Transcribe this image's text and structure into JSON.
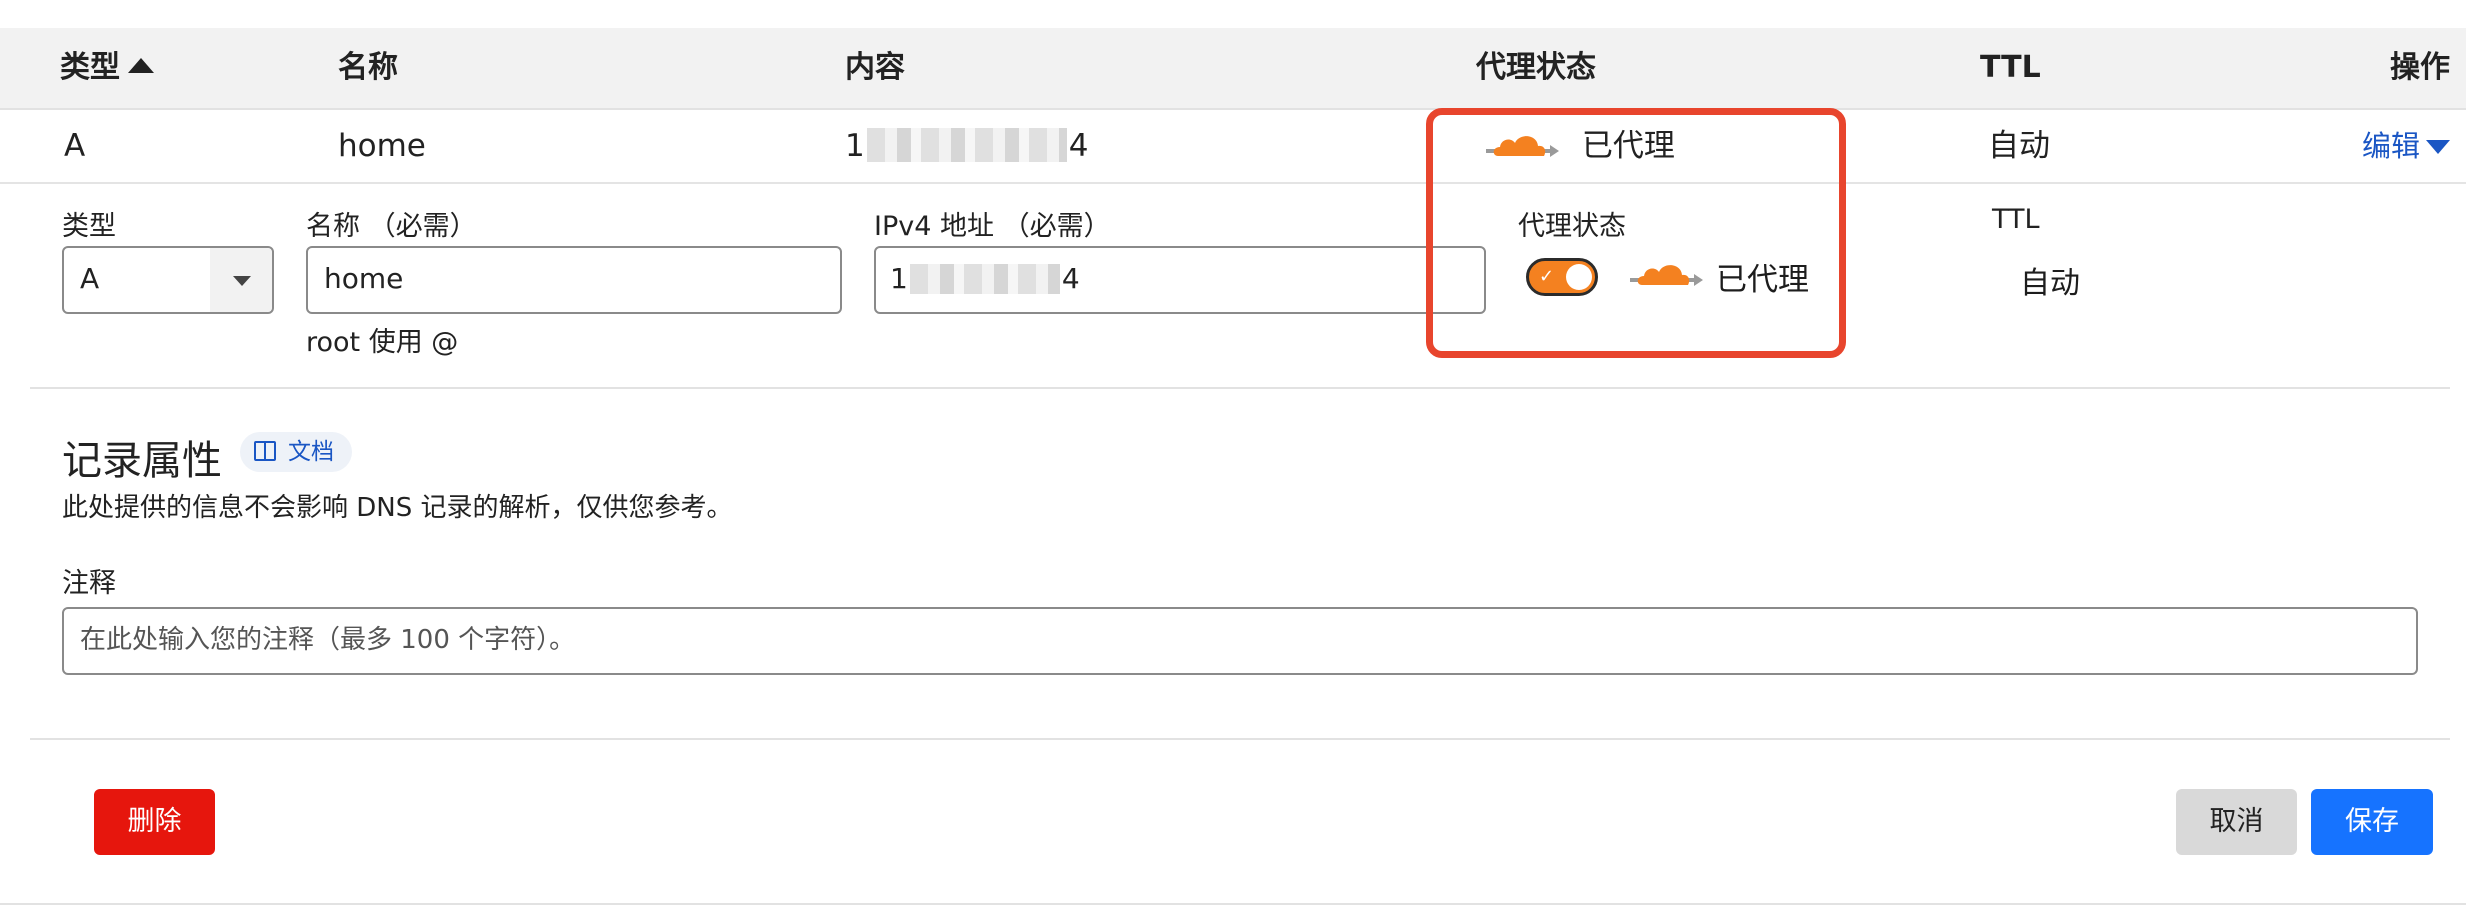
{
  "table": {
    "headers": {
      "type": "类型",
      "name": "名称",
      "content": "内容",
      "proxy": "代理状态",
      "ttl": "TTL",
      "actions": "操作"
    }
  },
  "record": {
    "type": "A",
    "name": "home",
    "content_start": "1",
    "content_end": "4",
    "proxy_status": "已代理",
    "ttl": "自动",
    "edit_label": "编辑"
  },
  "form": {
    "type_label": "类型",
    "type_value": "A",
    "name_label": "名称 （必需）",
    "name_value": "home",
    "name_help": "root 使用 @",
    "ipv4_label": "IPv4 地址 （必需）",
    "ipv4_start": "1",
    "ipv4_end": "4",
    "proxy_label": "代理状态",
    "proxy_enabled": true,
    "proxy_text": "已代理",
    "ttl_label": "TTL",
    "ttl_value": "自动"
  },
  "attributes": {
    "title": "记录属性",
    "docs_label": "文档",
    "description": "此处提供的信息不会影响 DNS 记录的解析，仅供您参考。",
    "comment_label": "注释",
    "comment_placeholder": "在此处输入您的注释（最多 100 个字符）。"
  },
  "buttons": {
    "delete": "删除",
    "cancel": "取消",
    "save": "保存"
  },
  "colors": {
    "cloudflare_orange": "#f48120",
    "link_blue": "#1a56c4",
    "highlight_red": "#e8452d",
    "delete_red": "#e6160d",
    "save_blue": "#1673ff"
  }
}
